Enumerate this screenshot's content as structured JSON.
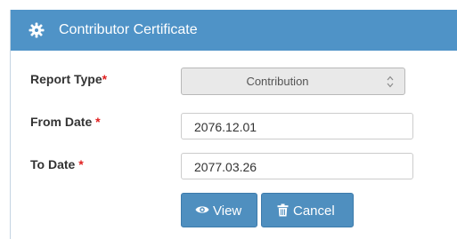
{
  "panel": {
    "title": "Contributor Certificate",
    "header_icon": "gear-icon"
  },
  "form": {
    "report_type": {
      "label": "Report Type",
      "required_mark": "*",
      "value": "Contribution"
    },
    "from_date": {
      "label": "From Date ",
      "required_mark": "*",
      "value": "2076.12.01"
    },
    "to_date": {
      "label": "To Date ",
      "required_mark": "*",
      "value": "2077.03.26"
    }
  },
  "buttons": {
    "view": {
      "label": "View",
      "icon": "eye-icon"
    },
    "cancel": {
      "label": "Cancel",
      "icon": "trash-icon"
    }
  },
  "colors": {
    "header_bg": "#4f93c7",
    "button_bg": "#4f8fbf",
    "required": "#e02020"
  }
}
